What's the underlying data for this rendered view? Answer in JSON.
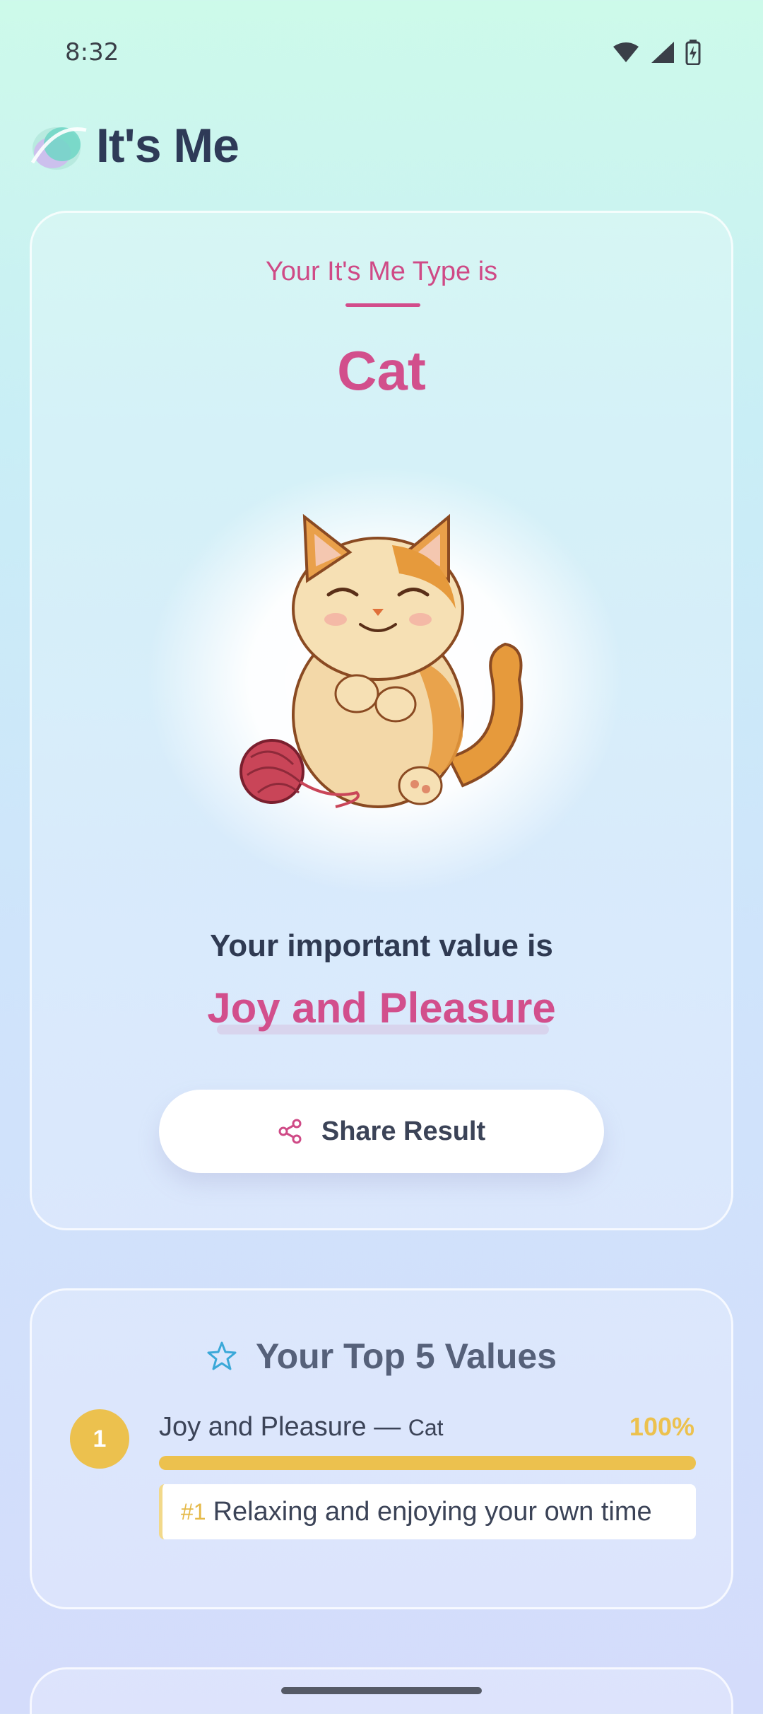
{
  "status_bar": {
    "time": "8:32",
    "icons": [
      "wifi-icon",
      "signal-icon",
      "battery-charging-icon"
    ]
  },
  "header": {
    "app_title": "It's Me"
  },
  "result": {
    "type_label": "Your It's Me Type is",
    "type_name": "Cat",
    "value_label": "Your important value is",
    "value_name": "Joy and Pleasure",
    "share_button": "Share Result"
  },
  "top5": {
    "title": "Your Top 5 Values",
    "items": [
      {
        "rank": "1",
        "name": "Joy and Pleasure",
        "separator": " — ",
        "type": "Cat",
        "percent_label": "100%",
        "percent": 1.0,
        "reason_rank": "#1",
        "reason": "Relaxing and enjoying your own time"
      }
    ]
  },
  "colors": {
    "accent_pink": "#d24f8c",
    "accent_gold": "#ecc14e",
    "text_dark": "#2f3a52"
  }
}
